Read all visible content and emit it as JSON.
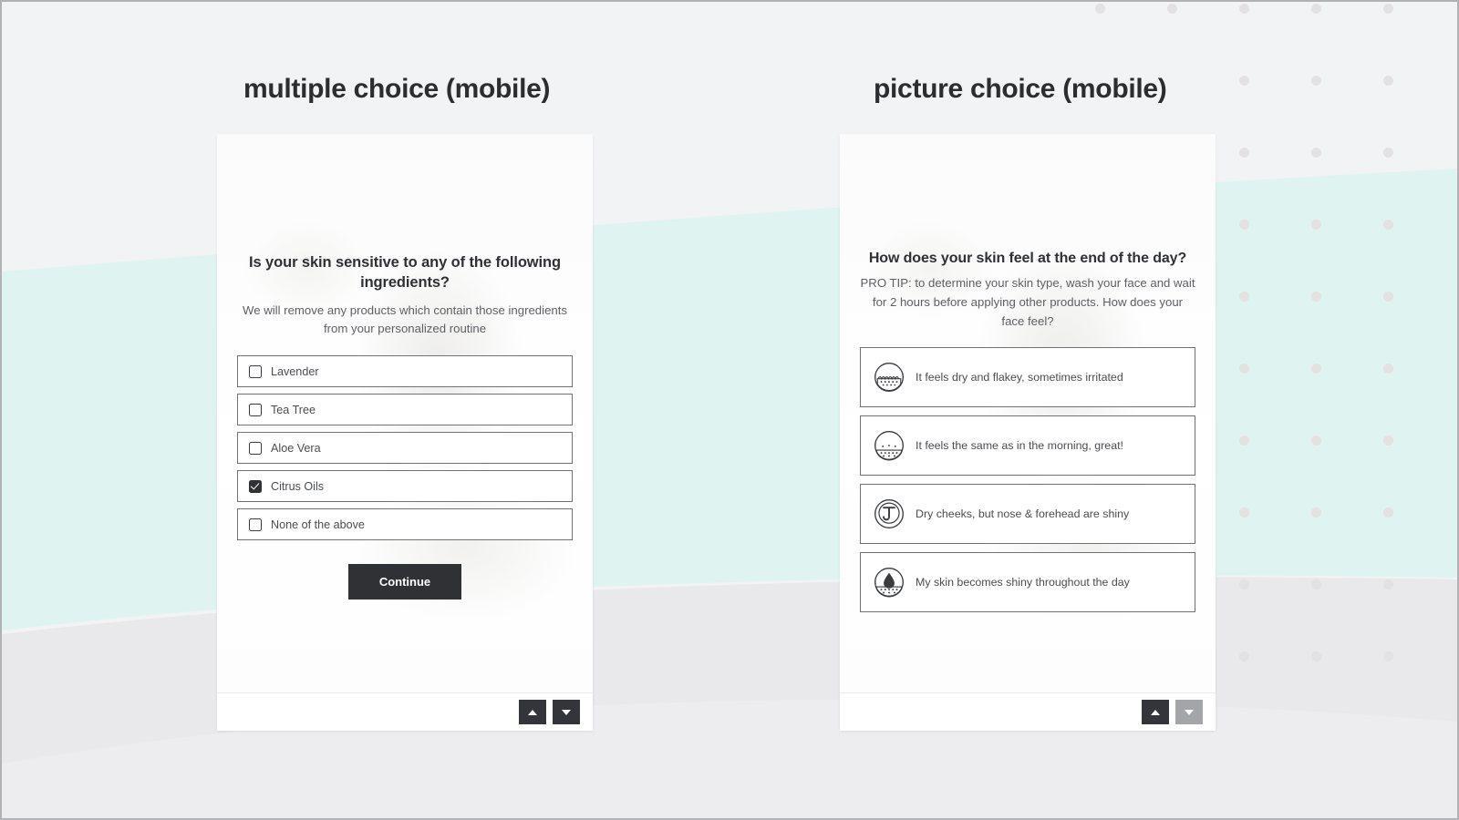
{
  "page": {
    "background_color": "#f2f3f5",
    "accent_mint": "#dff3f1",
    "accent_gray": "#e6e6e8",
    "dark": "#2f3135"
  },
  "panels": [
    {
      "title": "multiple choice (mobile)",
      "question": "Is your skin sensitive to any of the following ingredients?",
      "subtitle": "We will remove any products which contain those ingredients from your personalized routine",
      "options": [
        {
          "label": "Lavender",
          "checked": false
        },
        {
          "label": "Tea Tree",
          "checked": false
        },
        {
          "label": "Aloe Vera",
          "checked": false
        },
        {
          "label": "Citrus Oils",
          "checked": true
        },
        {
          "label": "None of the above",
          "checked": false
        }
      ],
      "cta_label": "Continue",
      "nav": {
        "up_enabled": true,
        "down_enabled": true
      }
    },
    {
      "title": "picture choice (mobile)",
      "question": "How does your skin feel at the end of the day?",
      "subtitle": "PRO TIP: to determine your skin type, wash your face and wait for 2 hours before applying other products. How does your face feel?",
      "options": [
        {
          "label": "It feels dry and flakey, sometimes irritated",
          "icon": "dry-skin-icon"
        },
        {
          "label": "It feels the same as in the morning, great!",
          "icon": "normal-skin-icon"
        },
        {
          "label": "Dry cheeks, but nose & forehead are shiny",
          "icon": "combination-skin-t-zone-icon"
        },
        {
          "label": "My skin becomes shiny throughout the day",
          "icon": "oily-skin-droplet-icon"
        }
      ],
      "nav": {
        "up_enabled": true,
        "down_enabled": false
      }
    }
  ]
}
